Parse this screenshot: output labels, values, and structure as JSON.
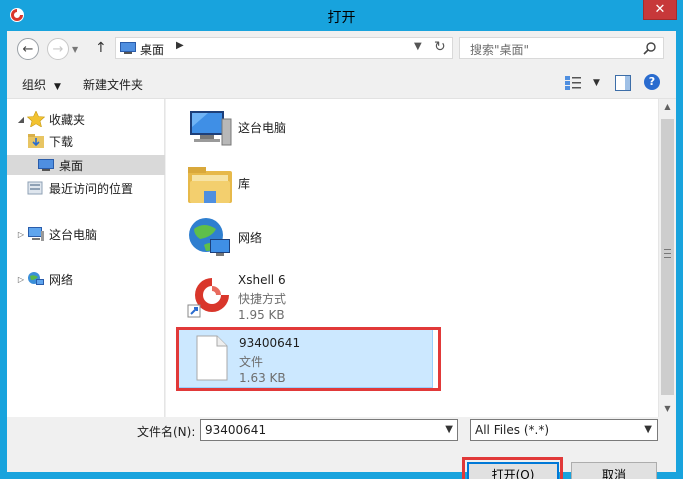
{
  "window": {
    "title": "打开",
    "close_glyph": "✕"
  },
  "nav": {
    "address_location": "桌面",
    "search_placeholder": "搜索\"桌面\""
  },
  "toolbar": {
    "organize_label": "组织",
    "new_folder_label": "新建文件夹"
  },
  "sidebar": {
    "items": [
      {
        "label": "收藏夹",
        "icon": "star-icon"
      },
      {
        "label": "下载",
        "icon": "download-folder-icon"
      },
      {
        "label": "桌面",
        "icon": "desktop-icon",
        "selected": true
      },
      {
        "label": "最近访问的位置",
        "icon": "recent-places-icon"
      },
      {
        "label": "这台电脑",
        "icon": "computer-icon"
      },
      {
        "label": "网络",
        "icon": "network-icon"
      }
    ]
  },
  "files": [
    {
      "name": "这台电脑",
      "line2": "",
      "line3": "",
      "icon": "computer-icon"
    },
    {
      "name": "库",
      "line2": "",
      "line3": "",
      "icon": "library-folder-icon"
    },
    {
      "name": "网络",
      "line2": "",
      "line3": "",
      "icon": "network-globe-icon"
    },
    {
      "name": "Xshell 6",
      "line2": "快捷方式",
      "line3": "1.95 KB",
      "icon": "xshell-shortcut-icon"
    },
    {
      "name": "93400641",
      "line2": "文件",
      "line3": "1.63 KB",
      "icon": "blank-file-icon",
      "selected": true
    }
  ],
  "bottom": {
    "filename_label": "文件名(N):",
    "filename_value": "93400641",
    "filter_value": "All Files (*.*)",
    "open_label": "打开(O)",
    "cancel_label": "取消"
  },
  "colors": {
    "title_bar": "#18a3dd",
    "selection": "#cce8ff",
    "highlight_box": "#e13939"
  }
}
